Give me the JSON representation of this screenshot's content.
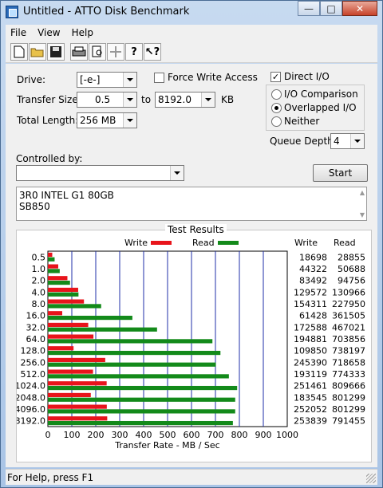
{
  "window": {
    "title": "Untitled - ATTO Disk Benchmark"
  },
  "menu": [
    "File",
    "View",
    "Help"
  ],
  "toolbar": {
    "icons": [
      "new-icon",
      "open-icon",
      "save-icon",
      "print-icon",
      "print-preview-icon",
      "move-icon",
      "help-icon",
      "context-help-icon"
    ]
  },
  "form": {
    "drive_label": "Drive:",
    "drive_value": "[-e-]",
    "force_write_label": "Force Write Access",
    "force_write_checked": false,
    "direct_io_label": "Direct I/O",
    "direct_io_checked": true,
    "transfer_size_label": "Transfer Size:",
    "transfer_from": "0.5",
    "to_label": "to",
    "transfer_to": "8192.0",
    "kb_label": "KB",
    "total_length_label": "Total Length:",
    "total_length_value": "256 MB",
    "io_options": [
      {
        "label": "I/O Comparison",
        "selected": false
      },
      {
        "label": "Overlapped I/O",
        "selected": true
      },
      {
        "label": "Neither",
        "selected": false
      }
    ],
    "queue_depth_label": "Queue Depth:",
    "queue_depth_value": "4",
    "controlled_by_label": "Controlled by:",
    "controlled_by_value": "",
    "start_label": "Start",
    "description_lines": [
      "3R0 INTEL G1 80GB",
      "SB850"
    ]
  },
  "results": {
    "group_title": "Test Results",
    "legend_write": "Write",
    "legend_read": "Read",
    "col_write": "Write",
    "col_read": "Read"
  },
  "chart_data": {
    "type": "bar",
    "orientation": "horizontal",
    "title": "Test Results",
    "xlabel": "Transfer Rate - MB / Sec",
    "xlim": [
      0,
      1000
    ],
    "xticks": [
      0,
      100,
      200,
      300,
      400,
      500,
      600,
      700,
      800,
      900,
      1000
    ],
    "grid": true,
    "legend_position": "top",
    "categories": [
      "0.5",
      "1.0",
      "2.0",
      "4.0",
      "8.0",
      "16.0",
      "32.0",
      "64.0",
      "128.0",
      "256.0",
      "512.0",
      "1024.0",
      "2048.0",
      "4096.0",
      "8192.0"
    ],
    "series": [
      {
        "name": "Write",
        "color": "#e8141b",
        "values": [
          18698,
          44322,
          83492,
          129572,
          154311,
          61428,
          172588,
          194881,
          109850,
          245390,
          193119,
          251461,
          183545,
          252052,
          253839
        ]
      },
      {
        "name": "Read",
        "color": "#138a1a",
        "values": [
          28855,
          50688,
          94756,
          130966,
          227950,
          361505,
          467021,
          703856,
          738197,
          718658,
          774333,
          809666,
          801299,
          801299,
          791455
        ]
      }
    ],
    "value_unit_note": ""
  }
}
